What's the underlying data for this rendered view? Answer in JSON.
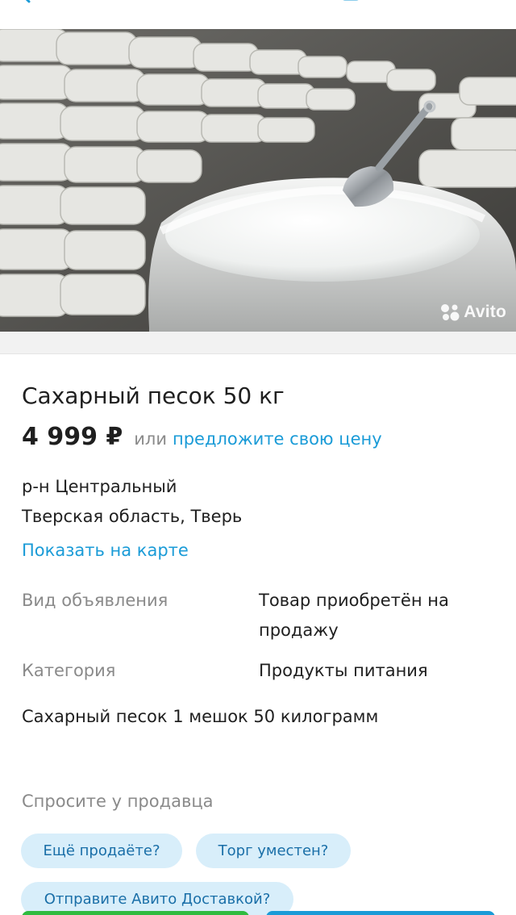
{
  "listing": {
    "title": "Сахарный песок 50 кг",
    "price": "4 999 ₽",
    "price_or": "или",
    "price_offer_link": "предложите свою цену",
    "watermark": "Avito"
  },
  "location": {
    "district": "р-н Центральный",
    "region_city": "Тверская область, Тверь",
    "map_link": "Показать на карте"
  },
  "params": [
    {
      "label": "Вид объявления",
      "value": "Товар приобретён на продажу"
    },
    {
      "label": "Категория",
      "value": "Продукты питания"
    }
  ],
  "description": "Сахарный песок 1 мешок 50 килограмм",
  "ask_seller": {
    "title": "Спросите у продавца",
    "chips": [
      "Ещё продаёте?",
      "Торг уместен?",
      "Отправите Авито Доставкой?"
    ]
  },
  "colors": {
    "link": "#1a9bd7",
    "chip_bg": "#d8eefa",
    "call_button": "#2fbb3f",
    "write_button": "#1a9bd7"
  },
  "icons": [
    "back-arrow-icon",
    "note-icon",
    "share-icon",
    "favorite-heart-icon",
    "avito-logo-icon"
  ]
}
